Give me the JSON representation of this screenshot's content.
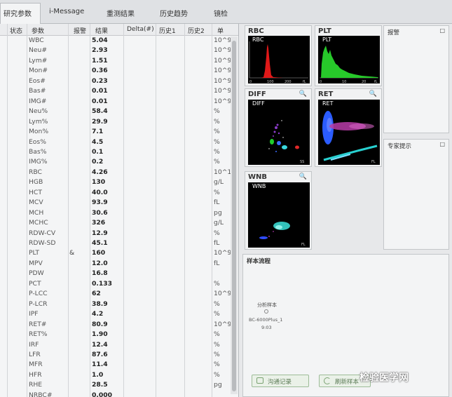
{
  "tabs": [
    "研究参数",
    "i-Message",
    "重测结果",
    "历史趋势",
    "镜检"
  ],
  "table": {
    "headers": [
      "状态",
      "参数",
      "报警",
      "结果",
      "Delta(#)",
      "历史1",
      "历史2",
      "单"
    ],
    "rows": [
      {
        "name": "WBC",
        "flag": "",
        "result": "5.04",
        "unit": "10^9"
      },
      {
        "name": "Neu#",
        "flag": "",
        "result": "2.93",
        "unit": "10^9"
      },
      {
        "name": "Lym#",
        "flag": "",
        "result": "1.51",
        "unit": "10^9"
      },
      {
        "name": "Mon#",
        "flag": "",
        "result": "0.36",
        "unit": "10^9"
      },
      {
        "name": "Eos#",
        "flag": "",
        "result": "0.23",
        "unit": "10^9"
      },
      {
        "name": "Bas#",
        "flag": "",
        "result": "0.01",
        "unit": "10^9"
      },
      {
        "name": "IMG#",
        "flag": "",
        "result": "0.01",
        "unit": "10^9"
      },
      {
        "name": "Neu%",
        "flag": "",
        "result": "58.4",
        "unit": "%"
      },
      {
        "name": "Lym%",
        "flag": "",
        "result": "29.9",
        "unit": "%"
      },
      {
        "name": "Mon%",
        "flag": "",
        "result": "7.1",
        "unit": "%"
      },
      {
        "name": "Eos%",
        "flag": "",
        "result": "4.5",
        "unit": "%"
      },
      {
        "name": "Bas%",
        "flag": "",
        "result": "0.1",
        "unit": "%"
      },
      {
        "name": "IMG%",
        "flag": "",
        "result": "0.2",
        "unit": "%"
      },
      {
        "name": "RBC",
        "flag": "",
        "result": "4.26",
        "unit": "10^1"
      },
      {
        "name": "HGB",
        "flag": "",
        "result": "130",
        "unit": "g/L"
      },
      {
        "name": "HCT",
        "flag": "",
        "result": "40.0",
        "unit": "%"
      },
      {
        "name": "MCV",
        "flag": "",
        "result": "93.9",
        "unit": "fL"
      },
      {
        "name": "MCH",
        "flag": "",
        "result": "30.6",
        "unit": "pg"
      },
      {
        "name": "MCHC",
        "flag": "",
        "result": "326",
        "unit": "g/L"
      },
      {
        "name": "RDW-CV",
        "flag": "",
        "result": "12.9",
        "unit": "%"
      },
      {
        "name": "RDW-SD",
        "flag": "",
        "result": "45.1",
        "unit": "fL"
      },
      {
        "name": "PLT",
        "flag": "&",
        "result": "160",
        "unit": "10^9"
      },
      {
        "name": "MPV",
        "flag": "",
        "result": "12.0",
        "unit": "fL"
      },
      {
        "name": "PDW",
        "flag": "",
        "result": "16.8",
        "unit": ""
      },
      {
        "name": "PCT",
        "flag": "",
        "result": "0.133",
        "unit": "%"
      },
      {
        "name": "P-LCC",
        "flag": "",
        "result": "62",
        "unit": "10^9"
      },
      {
        "name": "P-LCR",
        "flag": "",
        "result": "38.9",
        "unit": "%"
      },
      {
        "name": "IPF",
        "flag": "",
        "result": "4.2",
        "unit": "%"
      },
      {
        "name": "RET#",
        "flag": "",
        "result": "80.9",
        "unit": "10^9"
      },
      {
        "name": "RET%",
        "flag": "",
        "result": "1.90",
        "unit": "%"
      },
      {
        "name": "IRF",
        "flag": "",
        "result": "12.4",
        "unit": "%"
      },
      {
        "name": "LFR",
        "flag": "",
        "result": "87.6",
        "unit": "%"
      },
      {
        "name": "MFR",
        "flag": "",
        "result": "11.4",
        "unit": "%"
      },
      {
        "name": "HFR",
        "flag": "",
        "result": "1.0",
        "unit": "%"
      },
      {
        "name": "RHE",
        "flag": "",
        "result": "28.5",
        "unit": "pg"
      },
      {
        "name": "NRBC#",
        "flag": "",
        "result": "0.000",
        "unit": ""
      }
    ]
  },
  "graphs": {
    "rbc": {
      "title": "RBC",
      "plot_label": "RBC",
      "ticks": [
        "0",
        "100",
        "200",
        "fL"
      ]
    },
    "plt": {
      "title": "PLT",
      "plot_label": "PLT",
      "ticks": [
        "0",
        "10",
        "20",
        "fL"
      ]
    },
    "diff": {
      "title": "DIFF",
      "plot_label": "DIFF",
      "axis": "SS"
    },
    "ret": {
      "title": "RET",
      "plot_label": "RET",
      "axis": "FL"
    },
    "wnb": {
      "title": "WNB",
      "plot_label": "WNB",
      "axis": "FL"
    }
  },
  "panels": {
    "report": {
      "title": "报警",
      "close": "□"
    },
    "expert": {
      "title": "专家提示",
      "close": "□"
    },
    "workflow": {
      "title": "样本流程",
      "step_label": "分析样本",
      "device": "BC-6000Plus_1",
      "time": "9:03"
    }
  },
  "buttons": {
    "comm_record": "沟通记录",
    "refresh_sample": "刷新样本"
  },
  "watermark": "检验医学网",
  "icons": {
    "zoom": "🔍",
    "close": "□"
  }
}
